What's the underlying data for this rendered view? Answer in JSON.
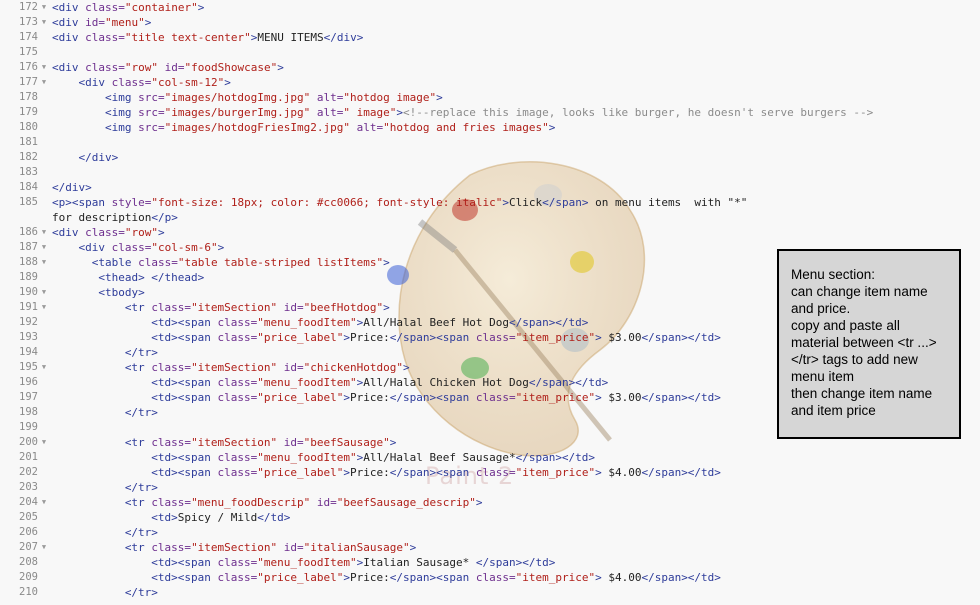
{
  "editor": {
    "lines": [
      {
        "num": "172",
        "fold": true,
        "indent": 0,
        "tokens": [
          [
            "tag",
            "<div "
          ],
          [
            "attr",
            "class="
          ],
          [
            "str",
            "\"container\""
          ],
          [
            "tag",
            ">"
          ]
        ]
      },
      {
        "num": "173",
        "fold": true,
        "indent": 0,
        "tokens": [
          [
            "tag",
            "<div "
          ],
          [
            "attr",
            "id="
          ],
          [
            "str",
            "\"menu\""
          ],
          [
            "tag",
            ">"
          ]
        ]
      },
      {
        "num": "174",
        "fold": false,
        "indent": 0,
        "tokens": [
          [
            "tag",
            "<div "
          ],
          [
            "attr",
            "class="
          ],
          [
            "str",
            "\"title text-center\""
          ],
          [
            "tag",
            ">"
          ],
          [
            "txt",
            "MENU ITEMS"
          ],
          [
            "tag",
            "</div>"
          ]
        ]
      },
      {
        "num": "175",
        "fold": false,
        "indent": 0,
        "tokens": []
      },
      {
        "num": "176",
        "fold": true,
        "indent": 0,
        "tokens": [
          [
            "tag",
            "<div "
          ],
          [
            "attr",
            "class="
          ],
          [
            "str",
            "\"row\""
          ],
          [
            "attr",
            " id="
          ],
          [
            "str",
            "\"foodShowcase\""
          ],
          [
            "tag",
            ">"
          ]
        ]
      },
      {
        "num": "177",
        "fold": true,
        "indent": 4,
        "tokens": [
          [
            "tag",
            "<div "
          ],
          [
            "attr",
            "class="
          ],
          [
            "str",
            "\"col-sm-12\""
          ],
          [
            "tag",
            ">"
          ]
        ]
      },
      {
        "num": "178",
        "fold": false,
        "indent": 8,
        "tokens": [
          [
            "tag",
            "<img "
          ],
          [
            "attr",
            "src="
          ],
          [
            "str",
            "\"images/hotdogImg.jpg\""
          ],
          [
            "attr",
            " alt="
          ],
          [
            "str",
            "\"hotdog image\""
          ],
          [
            "tag",
            ">"
          ]
        ]
      },
      {
        "num": "179",
        "fold": false,
        "indent": 8,
        "tokens": [
          [
            "tag",
            "<img "
          ],
          [
            "attr",
            "src="
          ],
          [
            "str",
            "\"images/burgerImg.jpg\""
          ],
          [
            "attr",
            " alt="
          ],
          [
            "str",
            "\" image\""
          ],
          [
            "tag",
            ">"
          ],
          [
            "com",
            "<!--replace this image, looks like burger, he doesn't serve burgers -->"
          ]
        ]
      },
      {
        "num": "180",
        "fold": false,
        "indent": 8,
        "tokens": [
          [
            "tag",
            "<img "
          ],
          [
            "attr",
            "src="
          ],
          [
            "str",
            "\"images/hotdogFriesImg2.jpg\""
          ],
          [
            "attr",
            " alt="
          ],
          [
            "str",
            "\"hotdog and fries images\""
          ],
          [
            "tag",
            ">"
          ]
        ]
      },
      {
        "num": "181",
        "fold": false,
        "indent": 0,
        "tokens": []
      },
      {
        "num": "182",
        "fold": false,
        "indent": 4,
        "tokens": [
          [
            "tag",
            "</div>"
          ]
        ]
      },
      {
        "num": "183",
        "fold": false,
        "indent": 0,
        "tokens": []
      },
      {
        "num": "184",
        "fold": false,
        "indent": 0,
        "tokens": [
          [
            "tag",
            "</div>"
          ]
        ]
      },
      {
        "num": "185",
        "fold": false,
        "indent": 0,
        "tokens": [
          [
            "tag",
            "<p><span "
          ],
          [
            "attr",
            "style="
          ],
          [
            "str",
            "\"font-size: 18px; color: #cc0066; font-style: italic\""
          ],
          [
            "tag",
            ">"
          ],
          [
            "txt",
            "Click"
          ],
          [
            "tag",
            "</span>"
          ],
          [
            "txt",
            " on menu items  with \"*\""
          ]
        ]
      },
      {
        "num": "",
        "fold": false,
        "indent": 0,
        "tokens": [
          [
            "txt",
            "for description"
          ],
          [
            "tag",
            "</p>"
          ]
        ]
      },
      {
        "num": "186",
        "fold": true,
        "indent": 0,
        "tokens": [
          [
            "tag",
            "<div "
          ],
          [
            "attr",
            "class="
          ],
          [
            "str",
            "\"row\""
          ],
          [
            "tag",
            ">"
          ]
        ]
      },
      {
        "num": "187",
        "fold": true,
        "indent": 4,
        "tokens": [
          [
            "tag",
            "<div "
          ],
          [
            "attr",
            "class="
          ],
          [
            "str",
            "\"col-sm-6\""
          ],
          [
            "tag",
            ">"
          ]
        ]
      },
      {
        "num": "188",
        "fold": true,
        "indent": 6,
        "tokens": [
          [
            "tag",
            "<table "
          ],
          [
            "attr",
            "class="
          ],
          [
            "str",
            "\"table table-striped listItems\""
          ],
          [
            "tag",
            ">"
          ]
        ]
      },
      {
        "num": "189",
        "fold": false,
        "indent": 7,
        "tokens": [
          [
            "tag",
            "<thead> </thead>"
          ]
        ]
      },
      {
        "num": "190",
        "fold": true,
        "indent": 7,
        "tokens": [
          [
            "tag",
            "<tbody>"
          ]
        ]
      },
      {
        "num": "191",
        "fold": true,
        "indent": 11,
        "tokens": [
          [
            "tag",
            "<tr "
          ],
          [
            "attr",
            "class="
          ],
          [
            "str",
            "\"itemSection\""
          ],
          [
            "attr",
            " id="
          ],
          [
            "str",
            "\"beefHotdog\""
          ],
          [
            "tag",
            ">"
          ]
        ]
      },
      {
        "num": "192",
        "fold": false,
        "indent": 15,
        "tokens": [
          [
            "tag",
            "<td><span "
          ],
          [
            "attr",
            "class="
          ],
          [
            "str",
            "\"menu_foodItem\""
          ],
          [
            "tag",
            ">"
          ],
          [
            "txt",
            "All/Halal Beef Hot Dog"
          ],
          [
            "tag",
            "</span></td>"
          ]
        ]
      },
      {
        "num": "193",
        "fold": false,
        "indent": 15,
        "tokens": [
          [
            "tag",
            "<td><span "
          ],
          [
            "attr",
            "class="
          ],
          [
            "str",
            "\"price_label\""
          ],
          [
            "tag",
            ">"
          ],
          [
            "txt",
            "Price:"
          ],
          [
            "tag",
            "</span><span "
          ],
          [
            "attr",
            "class="
          ],
          [
            "str",
            "\"item_price\""
          ],
          [
            "tag",
            ">"
          ],
          [
            "txt",
            " $3.00"
          ],
          [
            "tag",
            "</span></td>"
          ]
        ]
      },
      {
        "num": "194",
        "fold": false,
        "indent": 11,
        "tokens": [
          [
            "tag",
            "</tr>"
          ]
        ]
      },
      {
        "num": "195",
        "fold": true,
        "indent": 11,
        "tokens": [
          [
            "tag",
            "<tr "
          ],
          [
            "attr",
            "class="
          ],
          [
            "str",
            "\"itemSection\""
          ],
          [
            "attr",
            " id="
          ],
          [
            "str",
            "\"chickenHotdog\""
          ],
          [
            "tag",
            ">"
          ]
        ]
      },
      {
        "num": "196",
        "fold": false,
        "indent": 15,
        "tokens": [
          [
            "tag",
            "<td><span "
          ],
          [
            "attr",
            "class="
          ],
          [
            "str",
            "\"menu_foodItem\""
          ],
          [
            "tag",
            ">"
          ],
          [
            "txt",
            "All/Halal Chicken Hot Dog"
          ],
          [
            "tag",
            "</span></td>"
          ]
        ]
      },
      {
        "num": "197",
        "fold": false,
        "indent": 15,
        "tokens": [
          [
            "tag",
            "<td><span "
          ],
          [
            "attr",
            "class="
          ],
          [
            "str",
            "\"price_label\""
          ],
          [
            "tag",
            ">"
          ],
          [
            "txt",
            "Price:"
          ],
          [
            "tag",
            "</span><span "
          ],
          [
            "attr",
            "class="
          ],
          [
            "str",
            "\"item_price\""
          ],
          [
            "tag",
            ">"
          ],
          [
            "txt",
            " $3.00"
          ],
          [
            "tag",
            "</span></td>"
          ]
        ]
      },
      {
        "num": "198",
        "fold": false,
        "indent": 11,
        "tokens": [
          [
            "tag",
            "</tr>"
          ]
        ]
      },
      {
        "num": "199",
        "fold": false,
        "indent": 0,
        "tokens": []
      },
      {
        "num": "200",
        "fold": true,
        "indent": 11,
        "tokens": [
          [
            "tag",
            "<tr "
          ],
          [
            "attr",
            "class="
          ],
          [
            "str",
            "\"itemSection\""
          ],
          [
            "attr",
            " id="
          ],
          [
            "str",
            "\"beefSausage\""
          ],
          [
            "tag",
            ">"
          ]
        ]
      },
      {
        "num": "201",
        "fold": false,
        "indent": 15,
        "tokens": [
          [
            "tag",
            "<td><span "
          ],
          [
            "attr",
            "class="
          ],
          [
            "str",
            "\"menu_foodItem\""
          ],
          [
            "tag",
            ">"
          ],
          [
            "txt",
            "All/Halal Beef Sausage*"
          ],
          [
            "tag",
            "</span></td>"
          ]
        ]
      },
      {
        "num": "202",
        "fold": false,
        "indent": 15,
        "tokens": [
          [
            "tag",
            "<td><span "
          ],
          [
            "attr",
            "class="
          ],
          [
            "str",
            "\"price_label\""
          ],
          [
            "tag",
            ">"
          ],
          [
            "txt",
            "Price:"
          ],
          [
            "tag",
            "</span><span "
          ],
          [
            "attr",
            "class="
          ],
          [
            "str",
            "\"item_price\""
          ],
          [
            "tag",
            ">"
          ],
          [
            "txt",
            " $4.00"
          ],
          [
            "tag",
            "</span></td>"
          ]
        ]
      },
      {
        "num": "203",
        "fold": false,
        "indent": 11,
        "tokens": [
          [
            "tag",
            "</tr>"
          ]
        ]
      },
      {
        "num": "204",
        "fold": true,
        "indent": 11,
        "tokens": [
          [
            "tag",
            "<tr "
          ],
          [
            "attr",
            "class="
          ],
          [
            "str",
            "\"menu_foodDescrip\""
          ],
          [
            "attr",
            " id="
          ],
          [
            "str",
            "\"beefSausage_descrip\""
          ],
          [
            "tag",
            ">"
          ]
        ]
      },
      {
        "num": "205",
        "fold": false,
        "indent": 15,
        "tokens": [
          [
            "tag",
            "<td>"
          ],
          [
            "txt",
            "Spicy / Mild"
          ],
          [
            "tag",
            "</td>"
          ]
        ]
      },
      {
        "num": "206",
        "fold": false,
        "indent": 11,
        "tokens": [
          [
            "tag",
            "</tr>"
          ]
        ]
      },
      {
        "num": "207",
        "fold": true,
        "indent": 11,
        "tokens": [
          [
            "tag",
            "<tr "
          ],
          [
            "attr",
            "class="
          ],
          [
            "str",
            "\"itemSection\""
          ],
          [
            "attr",
            " id="
          ],
          [
            "str",
            "\"italianSausage\""
          ],
          [
            "tag",
            ">"
          ]
        ]
      },
      {
        "num": "208",
        "fold": false,
        "indent": 15,
        "tokens": [
          [
            "tag",
            "<td><span "
          ],
          [
            "attr",
            "class="
          ],
          [
            "str",
            "\"menu_foodItem\""
          ],
          [
            "tag",
            ">"
          ],
          [
            "txt",
            "Italian Sausage* "
          ],
          [
            "tag",
            "</span></td>"
          ]
        ]
      },
      {
        "num": "209",
        "fold": false,
        "indent": 15,
        "tokens": [
          [
            "tag",
            "<td><span "
          ],
          [
            "attr",
            "class="
          ],
          [
            "str",
            "\"price_label\""
          ],
          [
            "tag",
            ">"
          ],
          [
            "txt",
            "Price:"
          ],
          [
            "tag",
            "</span><span "
          ],
          [
            "attr",
            "class="
          ],
          [
            "str",
            "\"item_price\""
          ],
          [
            "tag",
            ">"
          ],
          [
            "txt",
            " $4.00"
          ],
          [
            "tag",
            "</span></td>"
          ]
        ]
      },
      {
        "num": "210",
        "fold": false,
        "indent": 11,
        "tokens": [
          [
            "tag",
            "</tr>"
          ]
        ]
      }
    ]
  },
  "watermark": {
    "text": "Paint 2"
  },
  "note": {
    "lines": [
      "Menu section:",
      "can change item name",
      "and price.",
      "copy and paste all",
      "material between <tr ...>",
      "</tr> tags to add new",
      "menu item",
      "then change item name",
      "and item price"
    ]
  },
  "colors": {
    "tag": "#2e3c9a",
    "attr": "#6e2f8e",
    "string": "#b0201a",
    "comment": "#8b8b8b"
  }
}
